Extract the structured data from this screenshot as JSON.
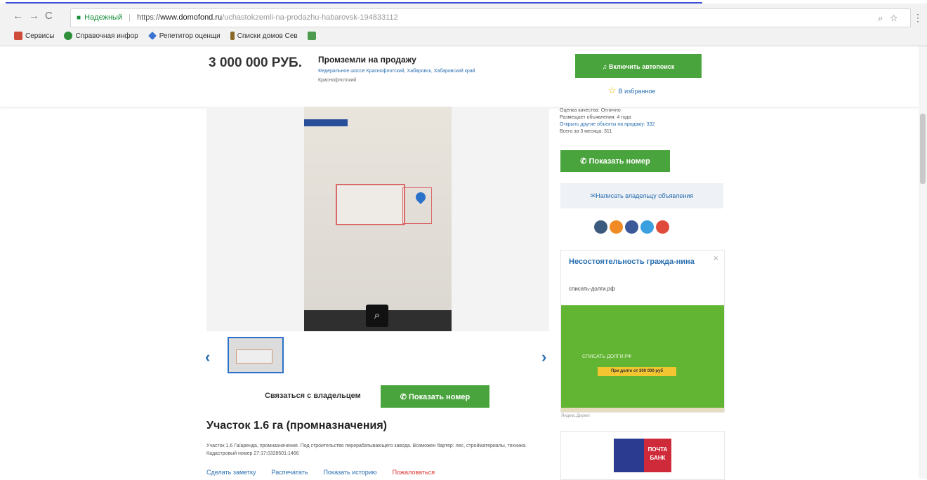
{
  "browser": {
    "secure_label": "Надежный",
    "url_prefix": "https://",
    "url_domain": "www.domofond.ru",
    "url_path": "/uchastokzemli-na-prodazhu-habarovsk-194833112",
    "bookmarks": [
      {
        "label": "Сервисы",
        "color": "#d04a3a"
      },
      {
        "label": "Справочная инфор",
        "color": "#2e8f3a"
      },
      {
        "label": "Репетитор оценщи",
        "color": "#3a73d0"
      },
      {
        "label": "Списки домов Сев",
        "color": "#8a6a2a"
      },
      {
        "label": "",
        "color": "#4d9b4d"
      }
    ]
  },
  "header": {
    "price": "3 000 000 РУБ.",
    "title": "Промземли на продажу",
    "address": "Федеральное шоссе Краснофлотский, Хабаровск, Хабаровский край",
    "district": "Краснофлотский",
    "notify_label": "Включить автопоиск",
    "favorite_label": "В избранное"
  },
  "gallery": {
    "zoom_icon": "⌕",
    "prev_label": "‹",
    "next_label": "›"
  },
  "main": {
    "contact_label": "Связаться с владельцем",
    "show_number_label": "Показать номер",
    "listing_title": "Участок 1.6 га (промназначения)",
    "description": "Участок 1.6 Га/аренда, промназначения. Под строительство перерабатывающего завода. Возможен бартер: лес, стройматериалы, техника. Кадастровый номер 27:17:0328501:1466",
    "actions": [
      "Сделать заметку",
      "Распечатать",
      "Показать историю",
      "Пожаловаться"
    ]
  },
  "sidebar": {
    "quality_line": "Оценка качества: Отлично",
    "placed_line": "Размещает объявления: 4 года",
    "other_objects_link": "Открыть другие объекты на продажу: 332",
    "total_line": "Всего за 3 месяца: 311",
    "show_number_label": "Показать номер",
    "write_owner_label": "Написать владельцу объявления",
    "share_colors": [
      "#3b5a7d",
      "#f08a24",
      "#3b5998",
      "#3aa0e0",
      "#e04a3a"
    ]
  },
  "ads": {
    "ad1_title": "Несостоятельность гражда-нина",
    "ad1_domain": "списать-долги.рф",
    "ad1_brand": "СПИСАТЬ ДОЛГИ.РФ",
    "ad1_cta": "При долге от 300 000 руб",
    "ad_label": "Яндекс.Директ",
    "ad2_bank": "ПОЧТА БАНК"
  }
}
